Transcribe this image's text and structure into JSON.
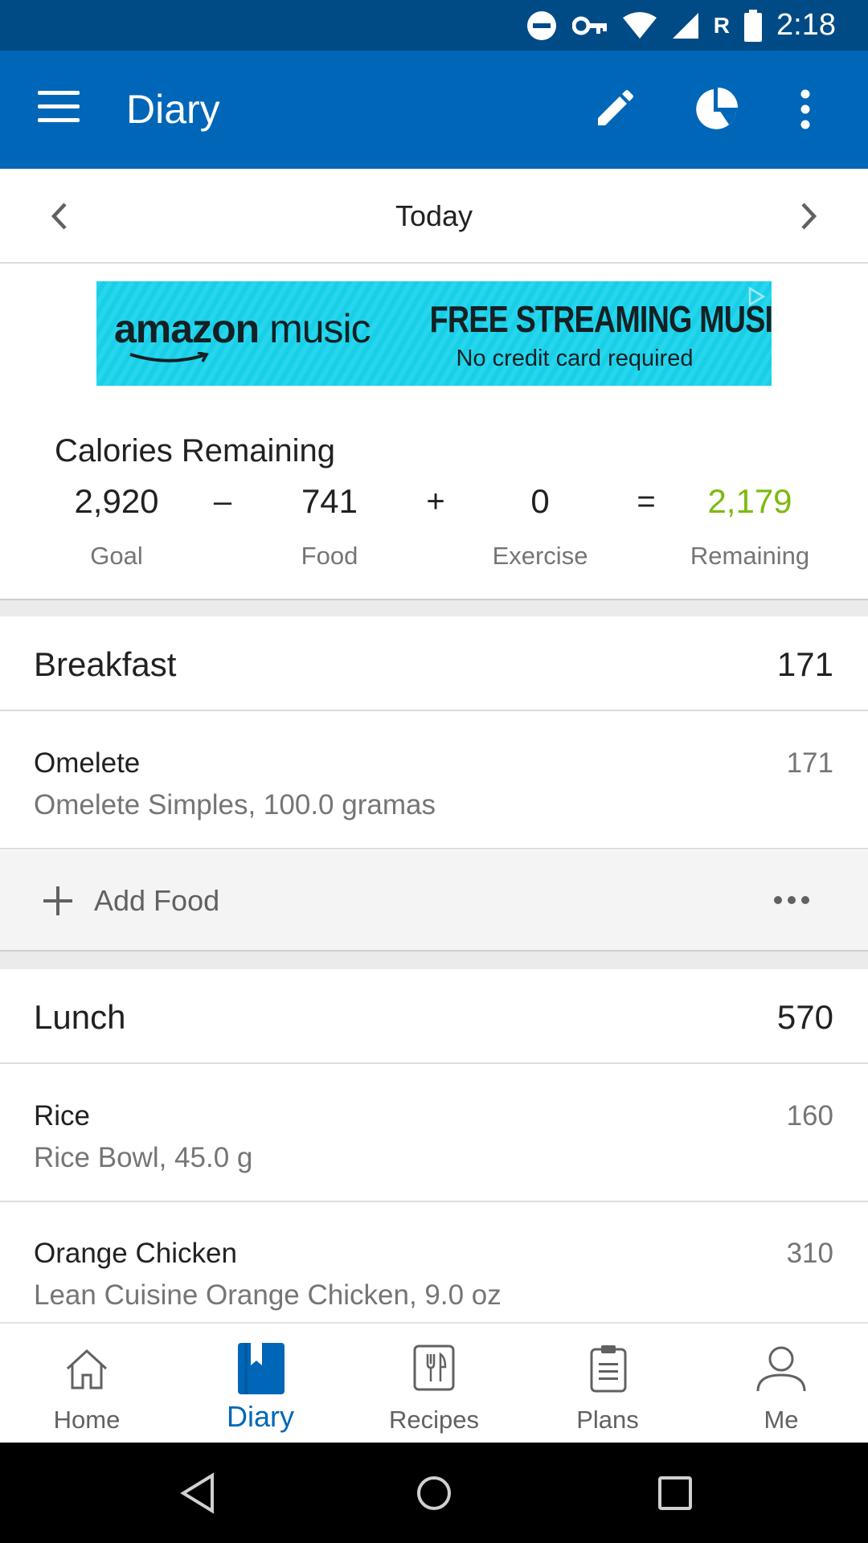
{
  "status_bar": {
    "time": "2:18",
    "roaming_indicator": "R",
    "icons": [
      "do-not-disturb-icon",
      "vpn-key-icon",
      "wifi-icon",
      "cell-signal-icon",
      "battery-icon"
    ]
  },
  "app_bar": {
    "title": "Diary",
    "icons": [
      "menu-icon",
      "edit-icon",
      "pie-chart-icon",
      "more-vert-icon"
    ],
    "background": "#0066b8"
  },
  "date_nav": {
    "label": "Today"
  },
  "ad": {
    "brand_prefix": "amazon",
    "brand_suffix": "music",
    "headline": "FREE STREAMING MUSIC",
    "subline": "No credit card required",
    "background": "#19d3ec"
  },
  "calories": {
    "title": "Calories Remaining",
    "goal": "2,920",
    "food": "741",
    "exercise": "0",
    "remaining": "2,179",
    "ops": [
      "–",
      "+",
      "="
    ],
    "labels": {
      "goal": "Goal",
      "food": "Food",
      "exercise": "Exercise",
      "remaining": "Remaining"
    },
    "remaining_color": "#7cba0f"
  },
  "meals": [
    {
      "name": "Breakfast",
      "calories": "171",
      "items": [
        {
          "name": "Omelete",
          "description": "Omelete Simples, 100.0 gramas",
          "calories": "171"
        }
      ],
      "add_food_label": "Add Food"
    },
    {
      "name": "Lunch",
      "calories": "570",
      "items": [
        {
          "name": "Rice",
          "description": "Rice Bowl, 45.0 g",
          "calories": "160"
        },
        {
          "name": "Orange Chicken",
          "description": "Lean Cuisine Orange Chicken, 9.0 oz",
          "calories": "310"
        }
      ]
    }
  ],
  "bottom_nav": {
    "items": [
      {
        "label": "Home",
        "icon": "home-icon"
      },
      {
        "label": "Diary",
        "icon": "diary-icon",
        "active": true
      },
      {
        "label": "Recipes",
        "icon": "recipes-icon"
      },
      {
        "label": "Plans",
        "icon": "plans-icon"
      },
      {
        "label": "Me",
        "icon": "profile-icon"
      }
    ],
    "active_color": "#0066b8"
  },
  "system_nav": {
    "icons": [
      "back-icon",
      "home-circle-icon",
      "recents-icon"
    ]
  }
}
